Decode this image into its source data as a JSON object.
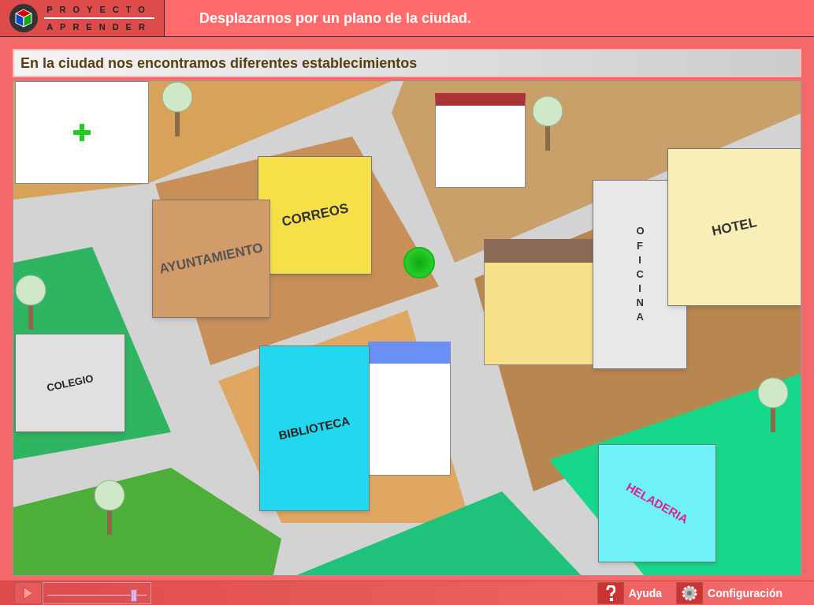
{
  "logo": {
    "top": "PROYECTO",
    "bottom": "APRENDER"
  },
  "title": "Desplazarnos por un plano de la ciudad.",
  "subtitle": "En la ciudad nos encontramos diferentes establecimientos",
  "map": {
    "buildings": [
      {
        "kind": "townhall",
        "label": "AYUNTAMIENTO"
      },
      {
        "kind": "post",
        "label": "CORREOS"
      },
      {
        "kind": "office",
        "label": "OFICINA"
      },
      {
        "kind": "hotel",
        "label": "HOTEL"
      },
      {
        "kind": "school",
        "label": "COLEGIO"
      },
      {
        "kind": "library",
        "label": "BIBLIOTECA"
      },
      {
        "kind": "icecream",
        "label": "HELADERIA"
      }
    ]
  },
  "player": {
    "level": 0.88
  },
  "buttons": [
    {
      "kind": "help",
      "label": "Ayuda"
    },
    {
      "kind": "settings",
      "label": "Configuración"
    }
  ]
}
